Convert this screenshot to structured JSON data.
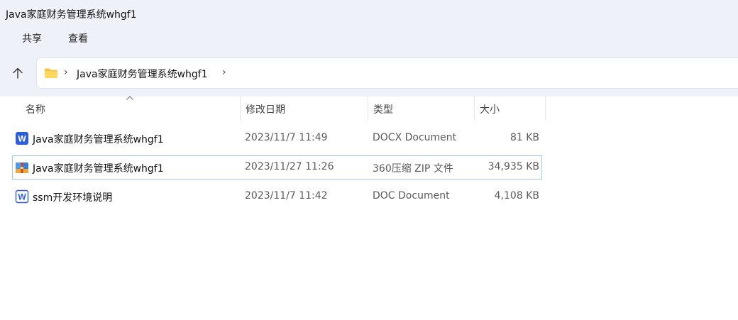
{
  "window": {
    "title": "Java家庭财务管理系统whgf1"
  },
  "ribbon": {
    "tabs": [
      "共享",
      "查看"
    ]
  },
  "address_bar": {
    "separator": "›",
    "crumbs": [
      "Java家庭财务管理系统whgf1"
    ]
  },
  "columns": {
    "name": "名称",
    "modified": "修改日期",
    "type": "类型",
    "size": "大小"
  },
  "files": [
    {
      "name": "Java家庭财务管理系统whgf1",
      "modified": "2023/11/7 11:49",
      "type": "DOCX Document",
      "size": "81 KB",
      "icon": "word-docx-icon",
      "selected": false
    },
    {
      "name": "Java家庭财务管理系统whgf1",
      "modified": "2023/11/27 11:26",
      "type": "360压缩 ZIP 文件",
      "size": "34,935 KB",
      "icon": "zip-archive-icon",
      "selected": true
    },
    {
      "name": "ssm开发环境说明",
      "modified": "2023/11/7 11:42",
      "type": "DOC Document",
      "size": "4,108 KB",
      "icon": "word-doc-icon",
      "selected": false
    }
  ],
  "colors": {
    "toolbar_bg": "#eef2f8",
    "selection_border": "#9ec9ec",
    "word_blue": "#2b5fd9",
    "folder_yellow": "#f5c542"
  }
}
